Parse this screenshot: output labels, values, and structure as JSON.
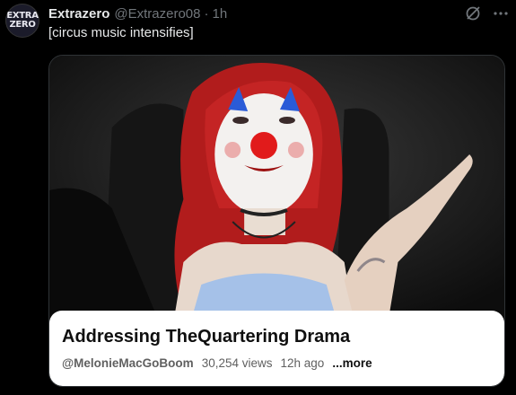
{
  "tweet": {
    "avatar_text_line1": "EXTRA",
    "avatar_text_line2": "ZERO",
    "display_name": "Extrazero",
    "handle": "@Extrazero08",
    "separator": "·",
    "time": "1h",
    "text": "[circus music intensifies]",
    "icons": [
      "grok-icon",
      "more-icon"
    ]
  },
  "card": {
    "title": "Addressing TheQuartering Drama",
    "channel": "@MelonieMacGoBoom",
    "views": "30,254 views",
    "age": "12h ago",
    "more_label": "...more"
  },
  "colors": {
    "background": "#000000",
    "text": "#e7e9ea",
    "muted": "#71767b",
    "card_info_bg": "#ffffff"
  }
}
